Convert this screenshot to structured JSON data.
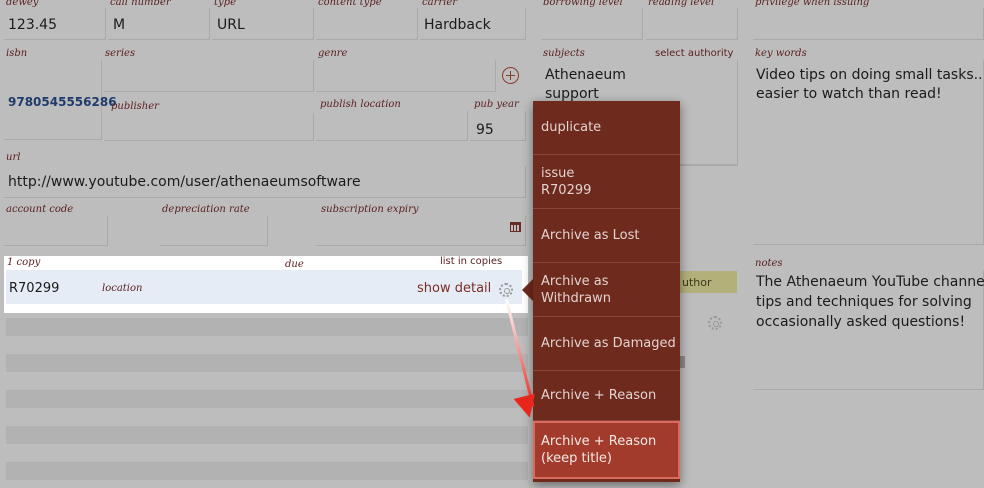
{
  "fields": {
    "dewey": {
      "label": "dewey",
      "value": "123.45"
    },
    "call_number": {
      "label": "call number",
      "value": "M"
    },
    "type": {
      "label": "type",
      "value": "URL"
    },
    "content_type": {
      "label": "content type",
      "value": ""
    },
    "carrier": {
      "label": "carrier",
      "value": "Hardback"
    },
    "borrowing_level": {
      "label": "borrowing level",
      "value": ""
    },
    "reading_level": {
      "label": "reading level",
      "value": ""
    },
    "privilege_when_issuing": {
      "label": "privilege when issuing",
      "value": ""
    },
    "isbn": {
      "label": "isbn",
      "value": "9780545556286"
    },
    "series": {
      "label": "series",
      "value": ""
    },
    "genre": {
      "label": "genre",
      "value": ""
    },
    "subjects": {
      "label": "subjects",
      "value_line1": "Athenaeum",
      "value_line2": "support",
      "select_authority": "select authority"
    },
    "key_words": {
      "label": "key words",
      "value_line1": "Video tips on doing small tasks...it's",
      "value_line2": "easier to watch than read!"
    },
    "publisher": {
      "label": "publisher",
      "value": ""
    },
    "publish_location": {
      "label": "publish location",
      "value": ""
    },
    "pub_year": {
      "label": "pub year",
      "value": "95"
    },
    "url": {
      "label": "url",
      "value": "http://www.youtube.com/user/athenaeumsoftware"
    },
    "account_code": {
      "label": "account code",
      "value": ""
    },
    "depreciation_rate": {
      "label": "depreciation rate",
      "value": ""
    },
    "subscription_expiry": {
      "label": "subscription expiry",
      "value": ""
    },
    "notes": {
      "label": "notes",
      "value_line1": "The Athenaeum YouTube channel ha",
      "value_line2": "tips and techniques for solving",
      "value_line3": "occasionally asked questions!"
    }
  },
  "copies": {
    "count_label": "1 copy",
    "due_label": "due",
    "list_in_copies": "list in copies",
    "row": {
      "barcode": "R70299",
      "location_label": "location",
      "show_detail": "show detail"
    }
  },
  "author_tab": "uthor",
  "context_menu": {
    "items": [
      {
        "label": "duplicate"
      },
      {
        "label": "issue",
        "sub": "R70299"
      },
      {
        "label": "Archive as Lost"
      },
      {
        "label": "Archive as Withdrawn"
      },
      {
        "label": "Archive as Damaged"
      },
      {
        "label": "Archive + Reason"
      },
      {
        "label": "Archive + Reason",
        "sub": "(keep title)",
        "highlighted": true
      }
    ]
  },
  "colors": {
    "menu_bg": "#6f2a1e",
    "menu_highlight": "#a23b2c",
    "label_color": "#5a1e1e",
    "callout_arrow": "#e8261e"
  }
}
